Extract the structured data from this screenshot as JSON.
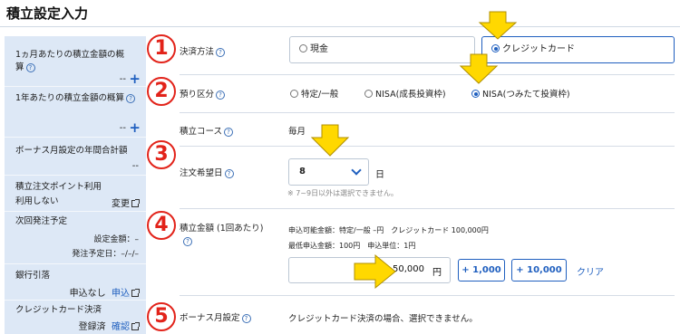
{
  "title": "積立設定入力",
  "sidebar": {
    "monthly_label_1": "1ヵ月あたりの積立金額の概",
    "monthly_label_2": "算",
    "monthly_value": "--",
    "yearly_label": "1年あたりの積立金額の概算",
    "yearly_value": "--",
    "bonus_total_label": "ボーナス月設定の年間合計額",
    "bonus_total_value": "--",
    "points_label": "積立注文ポイント利用",
    "points_value": "利用しない",
    "points_link": "変更",
    "next_label": "次回発注予定",
    "next_amount": "設定金額：–",
    "next_date": "発注予定日：–/–/–",
    "bank_label": "銀行引落",
    "bank_status": "申込なし",
    "bank_link": "申込",
    "card_label": "クレジットカード決済",
    "card_status": "登録済",
    "card_link": "確認"
  },
  "markers": [
    "1",
    "2",
    "3",
    "4",
    "5"
  ],
  "payment": {
    "label": "決済方法",
    "options": [
      "現金",
      "クレジットカード"
    ],
    "selected": "クレジットカード"
  },
  "account": {
    "label": "預り区分",
    "options": [
      "特定/一般",
      "NISA(成長投資枠)",
      "NISA(つみたて投資枠)"
    ],
    "selected": "NISA(つみたて投資枠)"
  },
  "course": {
    "label": "積立コース",
    "value": "毎月"
  },
  "order_day": {
    "label": "注文希望日",
    "value": "8",
    "unit": "日",
    "note": "※ 7~9日以外は選択できません。"
  },
  "amount": {
    "label": "積立金額 (1回あたり)",
    "available": "申込可能金額：特定/一般 –円　クレジットカード 100,000円",
    "min_info": "最低申込金額：100円　申込単位：1円",
    "value": "50,000",
    "unit": "円",
    "add_1000": "+ 1,000",
    "add_10000": "+ 10,000",
    "clear": "クリア"
  },
  "bonus": {
    "label": "ボーナス月設定",
    "message": "クレジットカード決済の場合、選択できません。"
  },
  "colors": {
    "accent": "#1f5fbf",
    "marker": "#e2231a",
    "arrow": "#ffd800",
    "sidebar_bg": "#dde8f6"
  }
}
